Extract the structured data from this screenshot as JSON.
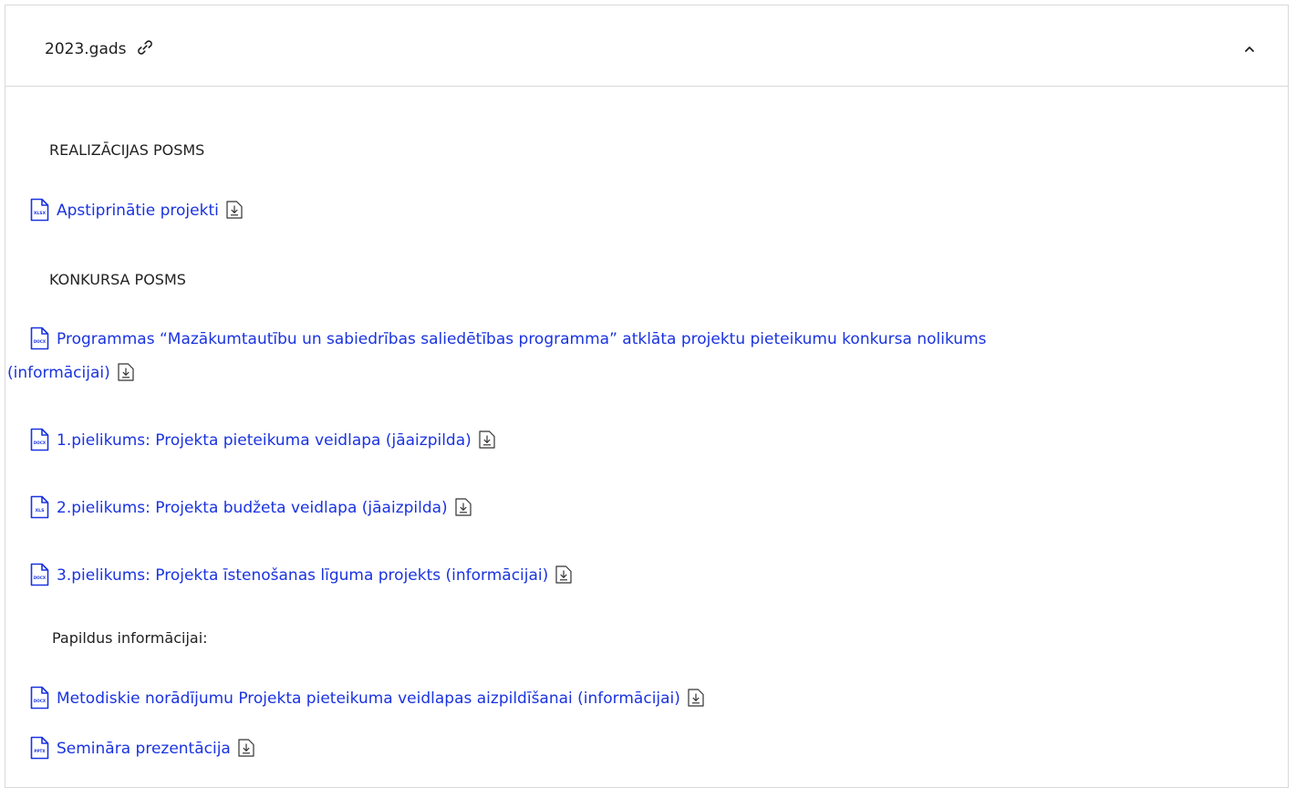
{
  "accordion": {
    "title": "2023.gads",
    "link_icon": "link-icon",
    "toggle_icon": "chevron-up-icon",
    "expanded": true
  },
  "sections": {
    "realizacijas": {
      "heading": "REALIZĀCIJAS POSMS",
      "files": [
        {
          "type": "XLSX",
          "label": "Apstiprinātie projekti"
        }
      ]
    },
    "konkursa": {
      "heading": "KONKURSA POSMS",
      "files": [
        {
          "type": "DOCX",
          "label_line1": "Programmas “Mazākumtautību un sabiedrības saliedētības programma” atklāta projektu pieteikumu konkursa nolikums",
          "label_line2": "(informācijai)"
        },
        {
          "type": "DOCX",
          "label": "1.pielikums: Projekta pieteikuma veidlapa (jāaizpilda)"
        },
        {
          "type": "XLS",
          "label": "2.pielikums: Projekta budžeta veidlapa (jāaizpilda)"
        },
        {
          "type": "DOCX",
          "label": "3.pielikums: Projekta īstenošanas līguma projekts (informācijai)"
        }
      ]
    },
    "papildus": {
      "heading": "Papildus informācijai:",
      "files": [
        {
          "type": "DOCX",
          "label": "Metodiskie norādījumu Projekta pieteikuma veidlapas aizpildīšanai (informācijai)"
        },
        {
          "type": "PPTX",
          "label": "Semināra prezentācija"
        }
      ]
    }
  },
  "colors": {
    "link": "#1a33e0",
    "border": "#d9d9d9",
    "text": "#1f1f1f"
  }
}
